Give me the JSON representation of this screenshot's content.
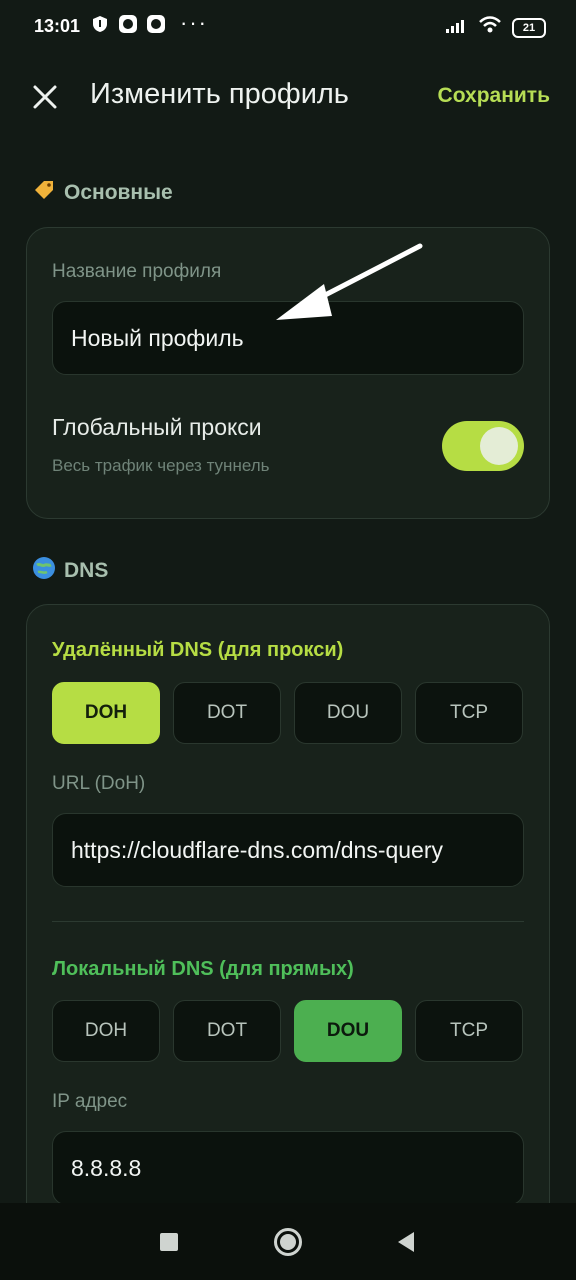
{
  "status_bar": {
    "time": "13:01",
    "battery": "21",
    "icons": [
      "shield-icon",
      "app-icon",
      "app-icon",
      "more-icon",
      "signal-icon",
      "wifi-icon",
      "battery-icon"
    ]
  },
  "header": {
    "title": "Изменить профиль",
    "save_label": "Сохранить"
  },
  "basic": {
    "section_title": "Основные",
    "profile_name_label": "Название профиля",
    "profile_name_value": "Новый профиль",
    "global_proxy_label": "Глобальный прокси",
    "global_proxy_hint": "Весь трафик через туннель",
    "global_proxy_enabled": true
  },
  "dns": {
    "section_title": "DNS",
    "remote": {
      "title": "Удалённый DNS (для прокси)",
      "options": [
        "DOH",
        "DOT",
        "DOU",
        "TCP"
      ],
      "selected": "DOH",
      "url_label": "URL (DoH)",
      "url_value": "https://cloudflare-dns.com/dns-query"
    },
    "local": {
      "title": "Локальный DNS (для прямых)",
      "options": [
        "DOH",
        "DOT",
        "DOU",
        "TCP"
      ],
      "selected": "DOU",
      "ip_label": "IP адрес",
      "ip_value": "8.8.8.8"
    }
  },
  "colors": {
    "accent_lime": "#b6dd44",
    "accent_green": "#4caf50",
    "background": "#121a15"
  }
}
